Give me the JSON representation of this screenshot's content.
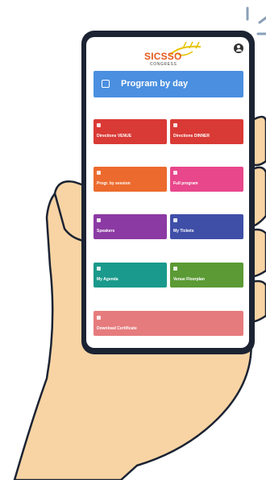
{
  "app": {
    "logo_text": "SICSSO",
    "logo_subtext": "CONGRESS"
  },
  "icons": {
    "user": "account-circle-icon",
    "calendar": "calendar-icon"
  },
  "main_button": {
    "label": "Program by day",
    "color": "#4a8fe0"
  },
  "tiles": [
    {
      "label": "Directions VENUE",
      "color": "#d93a35",
      "icon": "map-pin-icon"
    },
    {
      "label": "Directions DINNER",
      "color": "#d93a35",
      "icon": "map-pin-icon"
    },
    {
      "label": "Progr. by session",
      "color": "#ec6a2d",
      "icon": "list-icon"
    },
    {
      "label": "Full program",
      "color": "#e8478b",
      "icon": "document-icon"
    },
    {
      "label": "Speakers",
      "color": "#8b3aa3",
      "icon": "microphone-icon"
    },
    {
      "label": "My Tickets",
      "color": "#3f4fa8",
      "icon": "ticket-icon"
    },
    {
      "label": "My Agenda",
      "color": "#1a9a8c",
      "icon": "checkbox-icon"
    },
    {
      "label": "Venue Floorplan",
      "color": "#5b9a35",
      "icon": "map-icon"
    }
  ],
  "wide_tile": {
    "label": "Download Certificate",
    "color": "#e67b7d",
    "icon": "download-icon"
  },
  "colors": {
    "phone_frame": "#1c2333",
    "skin": "#f8d4a4",
    "accent_orange": "#e55a1e",
    "sparkle": "#8aa0b8"
  }
}
